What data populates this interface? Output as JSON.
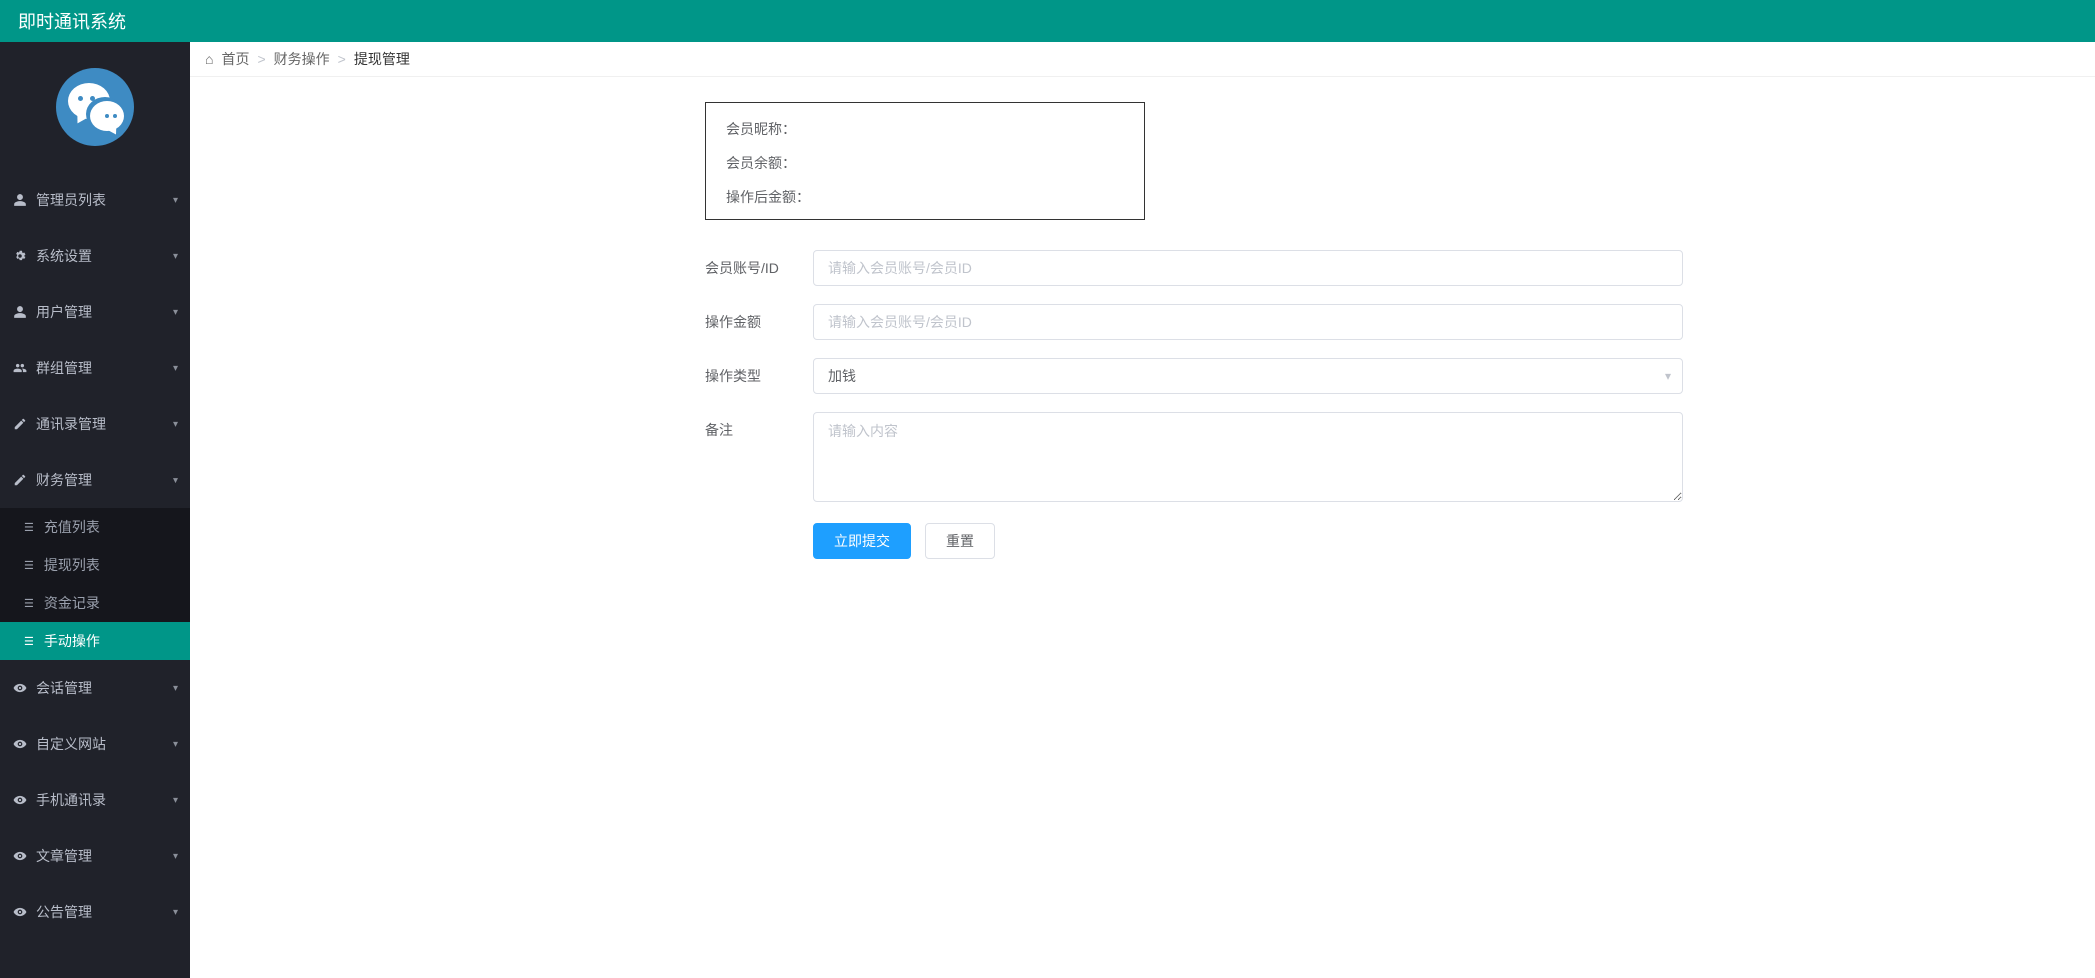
{
  "header": {
    "title": "即时通讯系统"
  },
  "sidebar": {
    "items": [
      {
        "label": "管理员列表",
        "icon": "user-icon"
      },
      {
        "label": "系统设置",
        "icon": "gear-icon"
      },
      {
        "label": "用户管理",
        "icon": "user-icon"
      },
      {
        "label": "群组管理",
        "icon": "users-icon"
      },
      {
        "label": "通讯录管理",
        "icon": "edit-icon"
      },
      {
        "label": "财务管理",
        "icon": "edit-icon",
        "open": true,
        "children": [
          {
            "label": "充值列表"
          },
          {
            "label": "提现列表"
          },
          {
            "label": "资金记录"
          },
          {
            "label": "手动操作",
            "active": true
          }
        ]
      },
      {
        "label": "会话管理",
        "icon": "eye-icon"
      },
      {
        "label": "自定义网站",
        "icon": "eye-icon"
      },
      {
        "label": "手机通讯录",
        "icon": "eye-icon"
      },
      {
        "label": "文章管理",
        "icon": "eye-icon"
      },
      {
        "label": "公告管理",
        "icon": "eye-icon"
      }
    ]
  },
  "breadcrumb": {
    "home": "首页",
    "parent": "财务操作",
    "current": "提现管理",
    "sep": ">"
  },
  "infobox": {
    "nickname_label": "会员昵称：",
    "balance_label": "会员余额：",
    "after_label": "操作后金额："
  },
  "form": {
    "account_label": "会员账号/ID",
    "account_placeholder": "请输入会员账号/会员ID",
    "amount_label": "操作金额",
    "amount_placeholder": "请输入会员账号/会员ID",
    "type_label": "操作类型",
    "type_value": "加钱",
    "remark_label": "备注",
    "remark_placeholder": "请输入内容",
    "submit": "立即提交",
    "reset": "重置"
  }
}
